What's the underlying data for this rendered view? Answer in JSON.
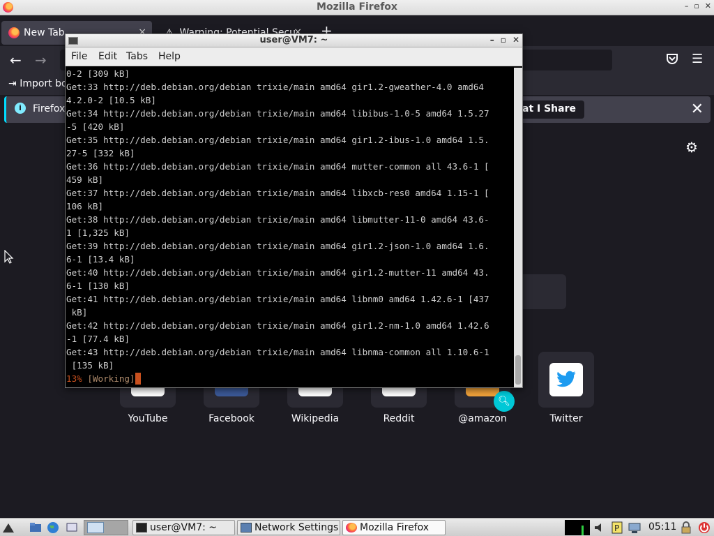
{
  "firefox": {
    "window_title": "Mozilla Firefox",
    "tabs": [
      {
        "label": "New Tab",
        "close": "×"
      },
      {
        "label": "Warning: Potential Secu",
        "close": "×"
      }
    ],
    "new_tab_plus": "+",
    "back": "←",
    "forward": "→",
    "bookmarks": {
      "import_label": "Import bo"
    },
    "notice": {
      "text": "Firefox",
      "button": "at I Share",
      "close": "✕"
    },
    "top_sites": [
      {
        "label": "YouTube"
      },
      {
        "label": "Facebook"
      },
      {
        "label": "Wikipedia"
      },
      {
        "label": "Reddit"
      },
      {
        "label": "@amazon"
      },
      {
        "label": "Twitter"
      }
    ],
    "colors": {
      "accent": "#00ddff",
      "tab_active": "#42414d",
      "background": "#1c1b22"
    }
  },
  "terminal": {
    "title": "user@VM7: ~",
    "menu": [
      "File",
      "Edit",
      "Tabs",
      "Help"
    ],
    "lines": [
      "0-2 [309 kB]",
      "Get:33 http://deb.debian.org/debian trixie/main amd64 gir1.2-gweather-4.0 amd64",
      "4.2.0-2 [10.5 kB]",
      "Get:34 http://deb.debian.org/debian trixie/main amd64 libibus-1.0-5 amd64 1.5.27",
      "-5 [420 kB]",
      "Get:35 http://deb.debian.org/debian trixie/main amd64 gir1.2-ibus-1.0 amd64 1.5.",
      "27-5 [332 kB]",
      "Get:36 http://deb.debian.org/debian trixie/main amd64 mutter-common all 43.6-1 [",
      "459 kB]",
      "Get:37 http://deb.debian.org/debian trixie/main amd64 libxcb-res0 amd64 1.15-1 [",
      "106 kB]",
      "Get:38 http://deb.debian.org/debian trixie/main amd64 libmutter-11-0 amd64 43.6-",
      "1 [1,325 kB]",
      "Get:39 http://deb.debian.org/debian trixie/main amd64 gir1.2-json-1.0 amd64 1.6.",
      "6-1 [13.4 kB]",
      "Get:40 http://deb.debian.org/debian trixie/main amd64 gir1.2-mutter-11 amd64 43.",
      "6-1 [130 kB]",
      "Get:41 http://deb.debian.org/debian trixie/main amd64 libnm0 amd64 1.42.6-1 [437",
      " kB]",
      "Get:42 http://deb.debian.org/debian trixie/main amd64 gir1.2-nm-1.0 amd64 1.42.6",
      "-1 [77.4 kB]",
      "Get:43 http://deb.debian.org/debian trixie/main amd64 libnma-common all 1.10.6-1",
      " [135 kB]"
    ],
    "status_percent": "13%",
    "status_text": " [Working]"
  },
  "taskbar": {
    "tasks": [
      {
        "label": "user@VM7: ~"
      },
      {
        "label": "Network Settings"
      },
      {
        "label": "Mozilla Firefox"
      }
    ],
    "clock": "05:11"
  }
}
